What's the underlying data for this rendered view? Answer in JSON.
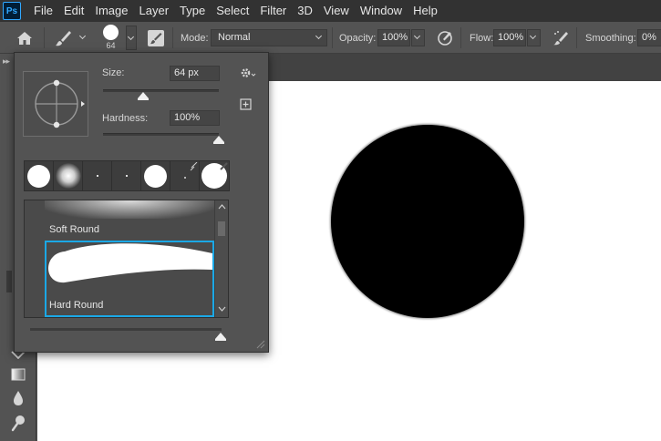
{
  "app": {
    "logo": "Ps"
  },
  "menu": [
    "File",
    "Edit",
    "Image",
    "Layer",
    "Type",
    "Select",
    "Filter",
    "3D",
    "View",
    "Window",
    "Help"
  ],
  "options_bar": {
    "brush_size": "64",
    "mode_label": "Mode:",
    "mode_value": "Normal",
    "opacity_label": "Opacity:",
    "opacity_value": "100%",
    "flow_label": "Flow:",
    "flow_value": "100%",
    "smoothing_label": "Smoothing:",
    "smoothing_value": "0%"
  },
  "brush_panel": {
    "size_label": "Size:",
    "size_value": "64 px",
    "hardness_label": "Hardness:",
    "hardness_value": "100%",
    "size_slider_level": 0.35,
    "hardness_slider_level": 1.0,
    "brushes": [
      {
        "name": "Soft Round"
      },
      {
        "name": "Hard Round",
        "selected": true
      }
    ]
  },
  "colors": {
    "selection": "#1ba8e6",
    "ps_blue": "#31a8ff",
    "canvas": "#ffffff",
    "brush_dab": "#000000"
  },
  "icons": [
    "home-icon",
    "brush-tool-icon",
    "brush-settings-icon",
    "pressure-opacity-icon",
    "airbrush-icon",
    "gear-icon",
    "new-preset-icon"
  ]
}
